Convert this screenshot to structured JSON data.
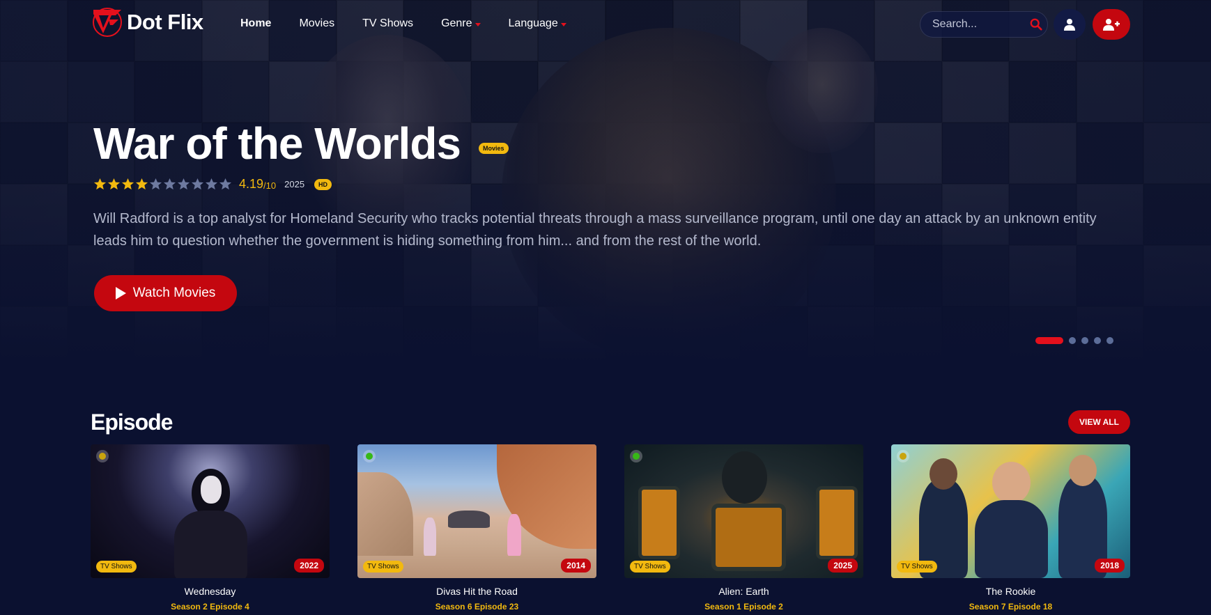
{
  "nav": {
    "logo_text": "Dot Flix",
    "menu": [
      {
        "label": "Home",
        "active": true,
        "dropdown": false
      },
      {
        "label": "Movies",
        "active": false,
        "dropdown": false
      },
      {
        "label": "TV Shows",
        "active": false,
        "dropdown": false
      },
      {
        "label": "Genre",
        "active": false,
        "dropdown": true
      },
      {
        "label": "Language",
        "active": false,
        "dropdown": true
      }
    ],
    "search_placeholder": "Search...",
    "icons": [
      "search-icon",
      "user-icon",
      "user-plus-icon"
    ]
  },
  "hero": {
    "title": "War of the Worlds",
    "type_badge": "Movies",
    "stars_total": 10,
    "stars_filled": 4,
    "rating": "4.19",
    "rating_max": "/10",
    "year": "2025",
    "quality": "HD",
    "description": "Will Radford is a top analyst for Homeland Security who tracks potential threats through a mass surveillance program, until one day an attack by an unknown entity leads him to question whether the government is hiding something from him... and from the rest of the world.",
    "cta_label": "Watch Movies",
    "slides_total": 5,
    "active_slide": 1
  },
  "episodes": {
    "title": "Episode",
    "view_all_label": "VIEW ALL",
    "items": [
      {
        "title": "Wednesday",
        "subtitle": "Season 2 Episode 4",
        "type": "TV Shows",
        "year": "2022",
        "status_color": "#c9a40e"
      },
      {
        "title": "Divas Hit the Road",
        "subtitle": "Season 6 Episode 23",
        "type": "TV Shows",
        "year": "2014",
        "status_color": "#37b817"
      },
      {
        "title": "Alien: Earth",
        "subtitle": "Season 1 Episode 2",
        "type": "TV Shows",
        "year": "2025",
        "status_color": "#37b817"
      },
      {
        "title": "The Rookie",
        "subtitle": "Season 7 Episode 18",
        "type": "TV Shows",
        "year": "2018",
        "status_color": "#c9a40e"
      }
    ]
  },
  "colors": {
    "background": "#0b1130",
    "accent_red": "#c4070f",
    "accent_yellow": "#f2b90f"
  }
}
